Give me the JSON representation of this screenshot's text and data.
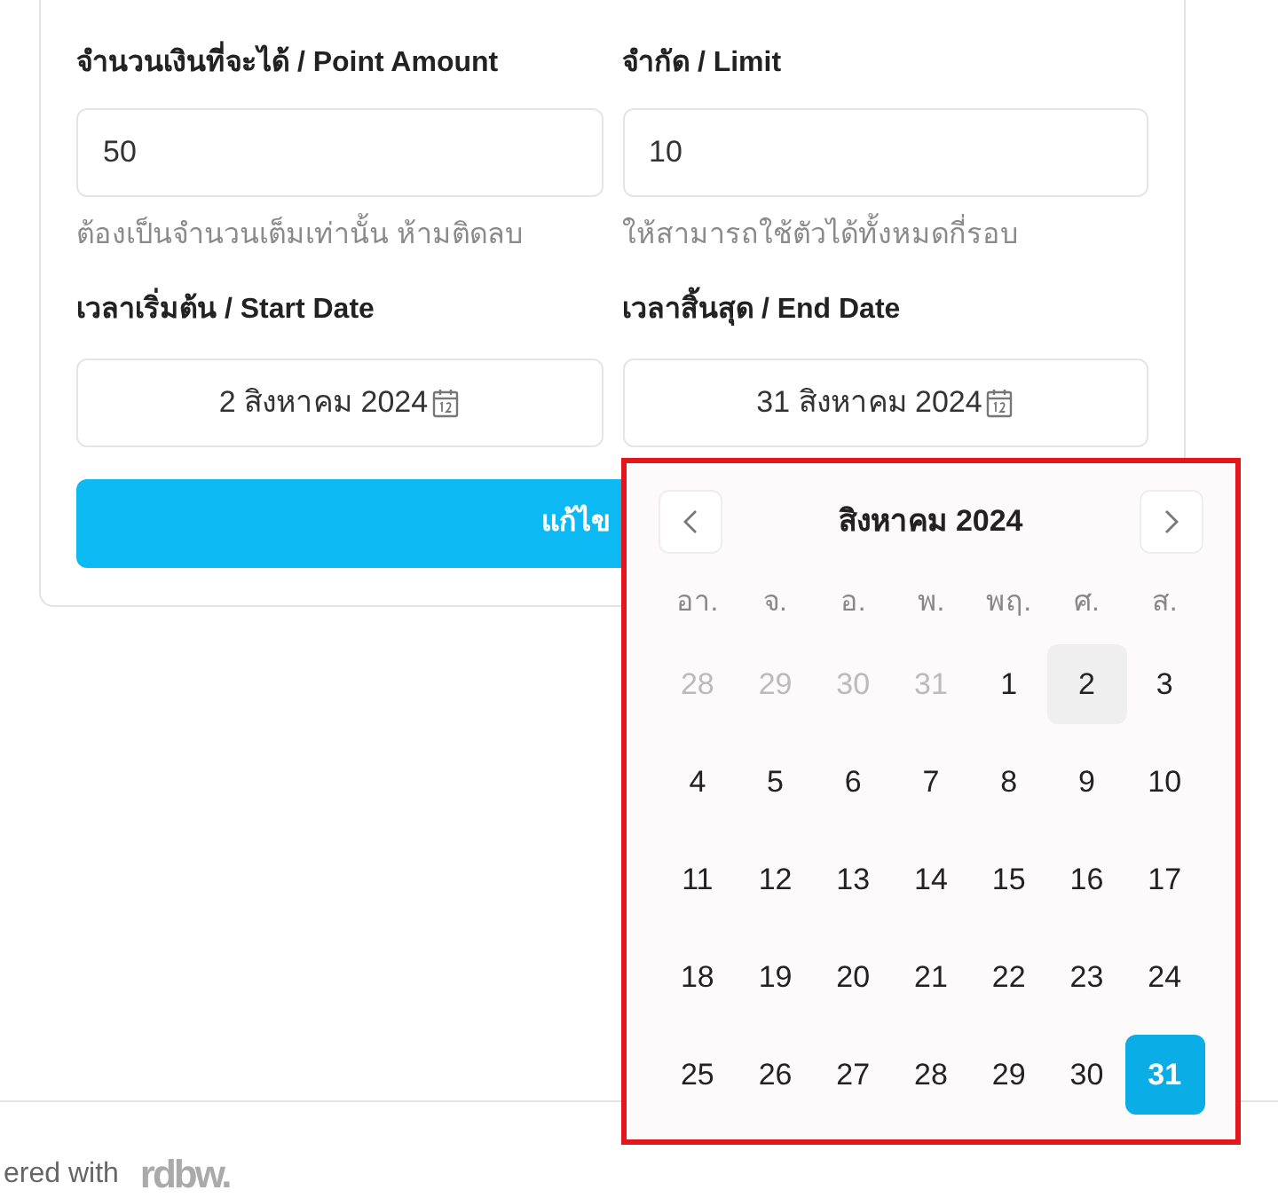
{
  "fields": [
    {
      "label": "จำนวนเงินที่จะได้ / Point Amount",
      "value": "50",
      "hint": "ต้องเป็นจำนวนเต็มเท่านั้น ห้ามติดลบ"
    },
    {
      "label": "จำกัด / Limit",
      "value": "10",
      "hint": "ให้สามารถใช้ตัวได้ทั้งหมดกี่รอบ"
    }
  ],
  "dates": [
    {
      "label": "เวลาเริ่มต้น / Start Date",
      "value": "2 สิงหาคม 2024"
    },
    {
      "label": "เวลาสิ้นสุด / End Date",
      "value": "31 สิงหาคม 2024"
    }
  ],
  "submit_button": "แก้ไข",
  "calendar": {
    "title": "สิงหาคม 2024",
    "weekdays": [
      "อา.",
      "จ.",
      "อ.",
      "พ.",
      "พฤ.",
      "ศ.",
      "ส."
    ],
    "weeks": [
      [
        {
          "day": "28",
          "muted": true,
          "selected": false,
          "marked": false
        },
        {
          "day": "29",
          "muted": true,
          "selected": false,
          "marked": false
        },
        {
          "day": "30",
          "muted": true,
          "selected": false,
          "marked": false
        },
        {
          "day": "31",
          "muted": true,
          "selected": false,
          "marked": false
        },
        {
          "day": "1",
          "muted": false,
          "selected": false,
          "marked": false
        },
        {
          "day": "2",
          "muted": false,
          "selected": false,
          "marked": true
        },
        {
          "day": "3",
          "muted": false,
          "selected": false,
          "marked": false
        }
      ],
      [
        {
          "day": "4",
          "muted": false,
          "selected": false,
          "marked": false
        },
        {
          "day": "5",
          "muted": false,
          "selected": false,
          "marked": false
        },
        {
          "day": "6",
          "muted": false,
          "selected": false,
          "marked": false
        },
        {
          "day": "7",
          "muted": false,
          "selected": false,
          "marked": false
        },
        {
          "day": "8",
          "muted": false,
          "selected": false,
          "marked": false
        },
        {
          "day": "9",
          "muted": false,
          "selected": false,
          "marked": false
        },
        {
          "day": "10",
          "muted": false,
          "selected": false,
          "marked": false
        }
      ],
      [
        {
          "day": "11",
          "muted": false,
          "selected": false,
          "marked": false
        },
        {
          "day": "12",
          "muted": false,
          "selected": false,
          "marked": false
        },
        {
          "day": "13",
          "muted": false,
          "selected": false,
          "marked": false
        },
        {
          "day": "14",
          "muted": false,
          "selected": false,
          "marked": false
        },
        {
          "day": "15",
          "muted": false,
          "selected": false,
          "marked": false
        },
        {
          "day": "16",
          "muted": false,
          "selected": false,
          "marked": false
        },
        {
          "day": "17",
          "muted": false,
          "selected": false,
          "marked": false
        }
      ],
      [
        {
          "day": "18",
          "muted": false,
          "selected": false,
          "marked": false
        },
        {
          "day": "19",
          "muted": false,
          "selected": false,
          "marked": false
        },
        {
          "day": "20",
          "muted": false,
          "selected": false,
          "marked": false
        },
        {
          "day": "21",
          "muted": false,
          "selected": false,
          "marked": false
        },
        {
          "day": "22",
          "muted": false,
          "selected": false,
          "marked": false
        },
        {
          "day": "23",
          "muted": false,
          "selected": false,
          "marked": false
        },
        {
          "day": "24",
          "muted": false,
          "selected": false,
          "marked": false
        }
      ],
      [
        {
          "day": "25",
          "muted": false,
          "selected": false,
          "marked": false
        },
        {
          "day": "26",
          "muted": false,
          "selected": false,
          "marked": false
        },
        {
          "day": "27",
          "muted": false,
          "selected": false,
          "marked": false
        },
        {
          "day": "28",
          "muted": false,
          "selected": false,
          "marked": false
        },
        {
          "day": "29",
          "muted": false,
          "selected": false,
          "marked": false
        },
        {
          "day": "30",
          "muted": false,
          "selected": false,
          "marked": false
        },
        {
          "day": "31",
          "muted": false,
          "selected": true,
          "marked": false
        }
      ]
    ]
  },
  "footer": {
    "text": "ered with",
    "logo": "rdbw."
  }
}
